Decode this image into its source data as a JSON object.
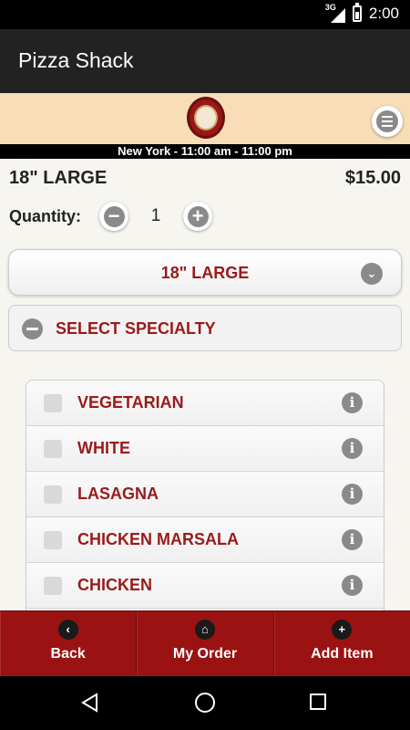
{
  "status_bar": {
    "network": "3G",
    "time": "2:00"
  },
  "app_bar": {
    "title": "Pizza Shack"
  },
  "banner": {
    "logo_icon": "pizza-shack-logo",
    "menu_icon": "menu-icon"
  },
  "hours": {
    "text": "New York - 11:00 am - 11:00 pm"
  },
  "item": {
    "size": "18\" LARGE",
    "price": "$15.00"
  },
  "quantity": {
    "label": "Quantity:",
    "value": "1",
    "minus": "−",
    "plus": "+"
  },
  "size_select": {
    "label": "18\" LARGE",
    "chevron": "⌄"
  },
  "specialty": {
    "label": "SELECT SPECIALTY"
  },
  "specialties": [
    {
      "label": "VEGETARIAN",
      "checked": false
    },
    {
      "label": "WHITE",
      "checked": false
    },
    {
      "label": "LASAGNA",
      "checked": false
    },
    {
      "label": "CHICKEN MARSALA",
      "checked": false
    },
    {
      "label": "CHICKEN",
      "checked": false
    }
  ],
  "info_glyph": "i",
  "bottom_tabs": [
    {
      "label": "Back",
      "icon": "‹"
    },
    {
      "label": "My Order",
      "icon": "⌂"
    },
    {
      "label": "Add Item",
      "icon": "+"
    }
  ],
  "colors": {
    "accent": "#9b1212",
    "text_accent": "#9a1a1a",
    "banner": "#f7deb7",
    "app_bar": "#222222"
  }
}
